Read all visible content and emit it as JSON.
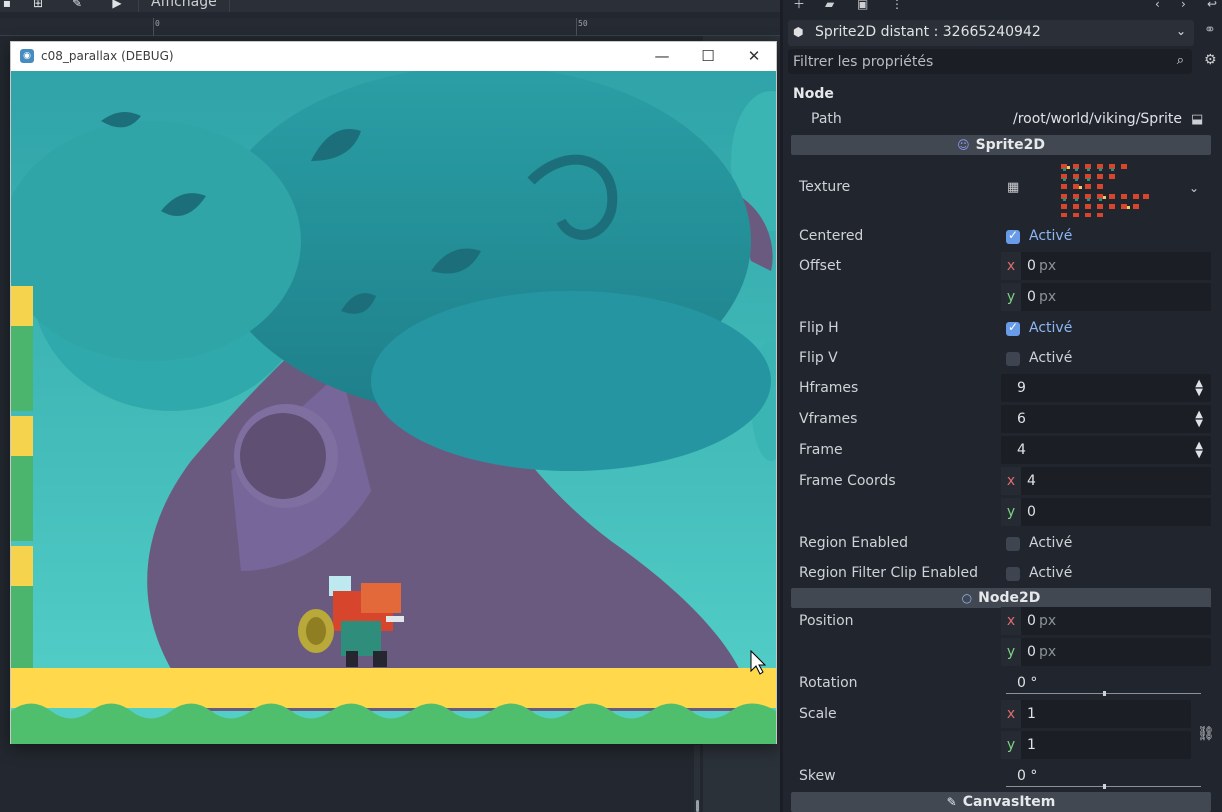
{
  "editor": {
    "view_menu_label": "Affichage",
    "ruler_labels": [
      "0",
      "50"
    ]
  },
  "game_window": {
    "title": "c08_parallax (DEBUG)",
    "minimize_glyph": "—",
    "maximize_glyph": "☐",
    "close_glyph": "✕"
  },
  "inspector": {
    "object_title": "Sprite2D distant : 32665240942",
    "filter_placeholder": "Filtrer les propriétés",
    "sections": {
      "node": "Node",
      "sprite2d": "Sprite2D",
      "node2d": "Node2D",
      "canvas_item": "CanvasItem"
    },
    "props": {
      "path_label": "Path",
      "path_value": "/root/world/viking/Sprite",
      "texture_label": "Texture",
      "centered_label": "Centered",
      "centered_value": "Activé",
      "offset_label": "Offset",
      "offset_x": "0",
      "offset_y": "0",
      "flip_h_label": "Flip H",
      "flip_h_value": "Activé",
      "flip_v_label": "Flip V",
      "flip_v_value": "Activé",
      "hframes_label": "Hframes",
      "hframes_value": "9",
      "vframes_label": "Vframes",
      "vframes_value": "6",
      "frame_label": "Frame",
      "frame_value": "4",
      "frame_coords_label": "Frame Coords",
      "frame_coords_x": "4",
      "frame_coords_y": "0",
      "region_enabled_label": "Region Enabled",
      "region_enabled_value": "Activé",
      "region_filter_label": "Region Filter Clip Enabled",
      "region_filter_value": "Activé",
      "position_label": "Position",
      "position_x": "0",
      "position_y": "0",
      "rotation_label": "Rotation",
      "rotation_value": "0 °",
      "scale_label": "Scale",
      "scale_x": "1",
      "scale_y": "1",
      "skew_label": "Skew",
      "skew_value": "0 °",
      "unit_px": "px",
      "axis_x": "x",
      "axis_y": "y"
    }
  },
  "colors": {
    "accent": "#699ce8",
    "axis_x": "#e06c6c",
    "axis_y": "#7ed183",
    "panel_bg": "#21262e",
    "section_bar": "#414852"
  }
}
